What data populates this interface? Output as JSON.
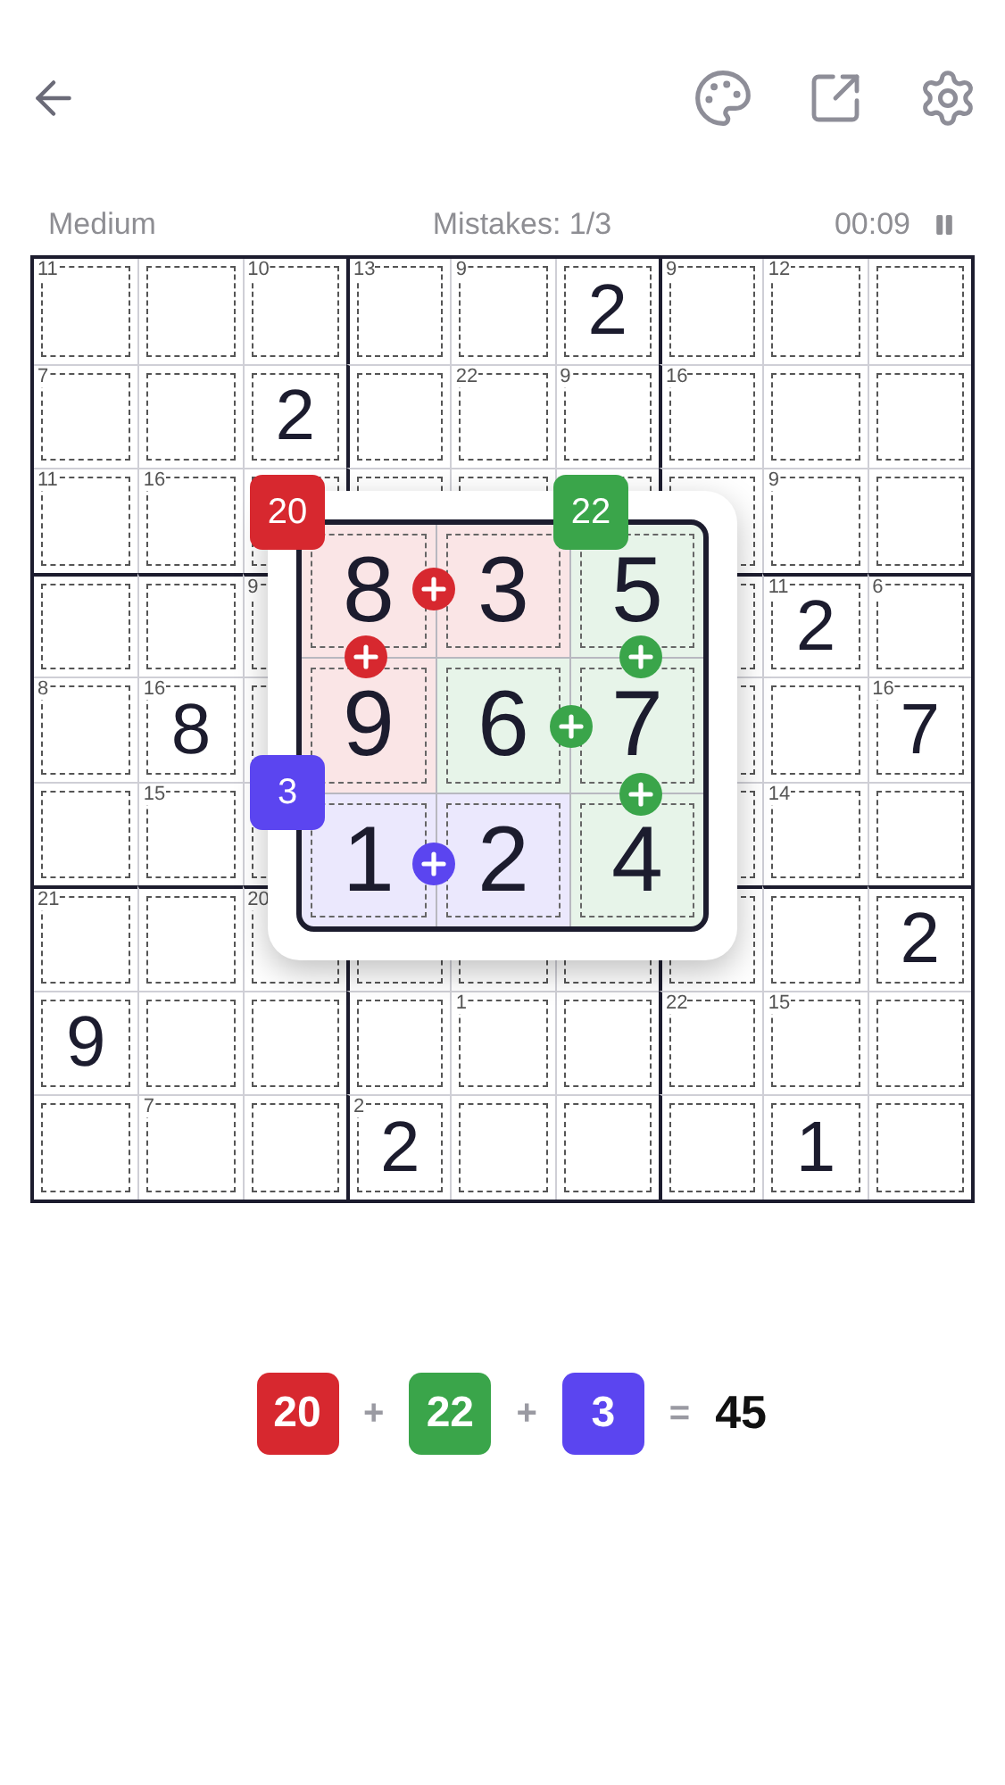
{
  "status": {
    "difficulty": "Medium",
    "mistakes": "Mistakes: 1/3",
    "timer": "00:09"
  },
  "grid": [
    [
      {
        "kind": "clue",
        "sum": "11"
      },
      {
        "kind": "blank"
      },
      {
        "kind": "clue",
        "sum": "10"
      },
      {
        "kind": "clue",
        "sum": "13"
      },
      {
        "kind": "clue",
        "sum": "9"
      },
      {
        "kind": "filled",
        "value": "2"
      },
      {
        "kind": "clue",
        "sum": "9"
      },
      {
        "kind": "clue",
        "sum": "12"
      },
      {
        "kind": "blank"
      }
    ],
    [
      {
        "kind": "clue",
        "sum": "7"
      },
      {
        "kind": "blank"
      },
      {
        "kind": "filled",
        "value": "2"
      },
      {
        "kind": "blank"
      },
      {
        "kind": "clue",
        "sum": "22"
      },
      {
        "kind": "clue",
        "sum": "9"
      },
      {
        "kind": "clue",
        "sum": "16"
      },
      {
        "kind": "blank"
      },
      {
        "kind": "blank"
      }
    ],
    [
      {
        "kind": "clue",
        "sum": "11"
      },
      {
        "kind": "clue",
        "sum": "16"
      },
      {
        "kind": "blank"
      },
      {
        "kind": "blank"
      },
      {
        "kind": "blank"
      },
      {
        "kind": "blank"
      },
      {
        "kind": "blank"
      },
      {
        "kind": "clue",
        "sum": "9"
      },
      {
        "kind": "blank"
      }
    ],
    [
      {
        "kind": "blank"
      },
      {
        "kind": "blank"
      },
      {
        "kind": "clue",
        "sum": "9"
      },
      {
        "kind": "hidden"
      },
      {
        "kind": "hidden"
      },
      {
        "kind": "hidden"
      },
      {
        "kind": "blank"
      },
      {
        "kind": "clue_filled",
        "sum": "11",
        "value": "2"
      },
      {
        "kind": "clue",
        "sum": "6"
      }
    ],
    [
      {
        "kind": "clue",
        "sum": "8"
      },
      {
        "kind": "clue_filled",
        "sum": "16",
        "value": "8"
      },
      {
        "kind": "blank"
      },
      {
        "kind": "hidden"
      },
      {
        "kind": "hidden"
      },
      {
        "kind": "hidden"
      },
      {
        "kind": "blank"
      },
      {
        "kind": "blank"
      },
      {
        "kind": "clue_filled",
        "sum": "16",
        "value": "7"
      }
    ],
    [
      {
        "kind": "blank"
      },
      {
        "kind": "clue",
        "sum": "15"
      },
      {
        "kind": "blank"
      },
      {
        "kind": "hidden"
      },
      {
        "kind": "hidden"
      },
      {
        "kind": "hidden"
      },
      {
        "kind": "blank"
      },
      {
        "kind": "clue",
        "sum": "14"
      },
      {
        "kind": "blank"
      }
    ],
    [
      {
        "kind": "clue",
        "sum": "21"
      },
      {
        "kind": "blank"
      },
      {
        "kind": "clue",
        "sum": "20"
      },
      {
        "kind": "blank"
      },
      {
        "kind": "blank"
      },
      {
        "kind": "blank"
      },
      {
        "kind": "blank"
      },
      {
        "kind": "blank"
      },
      {
        "kind": "filled",
        "value": "2"
      }
    ],
    [
      {
        "kind": "filled",
        "value": "9"
      },
      {
        "kind": "blank"
      },
      {
        "kind": "blank"
      },
      {
        "kind": "blank"
      },
      {
        "kind": "clue",
        "sum": "1"
      },
      {
        "kind": "blank"
      },
      {
        "kind": "clue",
        "sum": "22"
      },
      {
        "kind": "clue",
        "sum": "15"
      },
      {
        "kind": "blank"
      }
    ],
    [
      {
        "kind": "blank"
      },
      {
        "kind": "clue",
        "sum": "7"
      },
      {
        "kind": "blank"
      },
      {
        "kind": "clue_filled",
        "sum": "2",
        "value": "2"
      },
      {
        "kind": "blank"
      },
      {
        "kind": "blank"
      },
      {
        "kind": "blank"
      },
      {
        "kind": "filled",
        "value": "1"
      },
      {
        "kind": "blank"
      }
    ]
  ],
  "popup": {
    "badges": [
      {
        "text": "20",
        "color": "#d7282f"
      },
      {
        "text": "22",
        "color": "#3aa54a"
      },
      {
        "text": "3",
        "color": "#5b45f0"
      }
    ],
    "cells": [
      {
        "value": "8",
        "color": "#d7282f",
        "plus_right": true,
        "plus_below": true
      },
      {
        "value": "3",
        "color": "#d7282f",
        "plus_right": false,
        "plus_below": false
      },
      {
        "value": "5",
        "color": "#3aa54a",
        "plus_right": false,
        "plus_below": true
      },
      {
        "value": "9",
        "color": "#d7282f",
        "plus_right": false,
        "plus_below": false
      },
      {
        "value": "6",
        "color": "#3aa54a",
        "plus_right": true,
        "plus_below": false
      },
      {
        "value": "7",
        "color": "#3aa54a",
        "plus_right": false,
        "plus_below": true
      },
      {
        "value": "1",
        "color": "#5b45f0",
        "plus_right": true,
        "plus_below": false
      },
      {
        "value": "2",
        "color": "#5b45f0",
        "plus_right": false,
        "plus_below": false
      },
      {
        "value": "4",
        "color": "#3aa54a",
        "plus_right": false,
        "plus_below": false
      }
    ]
  },
  "equation": [
    {
      "kind": "term",
      "text": "20",
      "color": "#d7282f"
    },
    {
      "kind": "op",
      "text": "+"
    },
    {
      "kind": "term",
      "text": "22",
      "color": "#3aa54a"
    },
    {
      "kind": "op",
      "text": "+"
    },
    {
      "kind": "term",
      "text": "3",
      "color": "#5b45f0"
    },
    {
      "kind": "op",
      "text": "="
    },
    {
      "kind": "total",
      "text": "45"
    }
  ]
}
